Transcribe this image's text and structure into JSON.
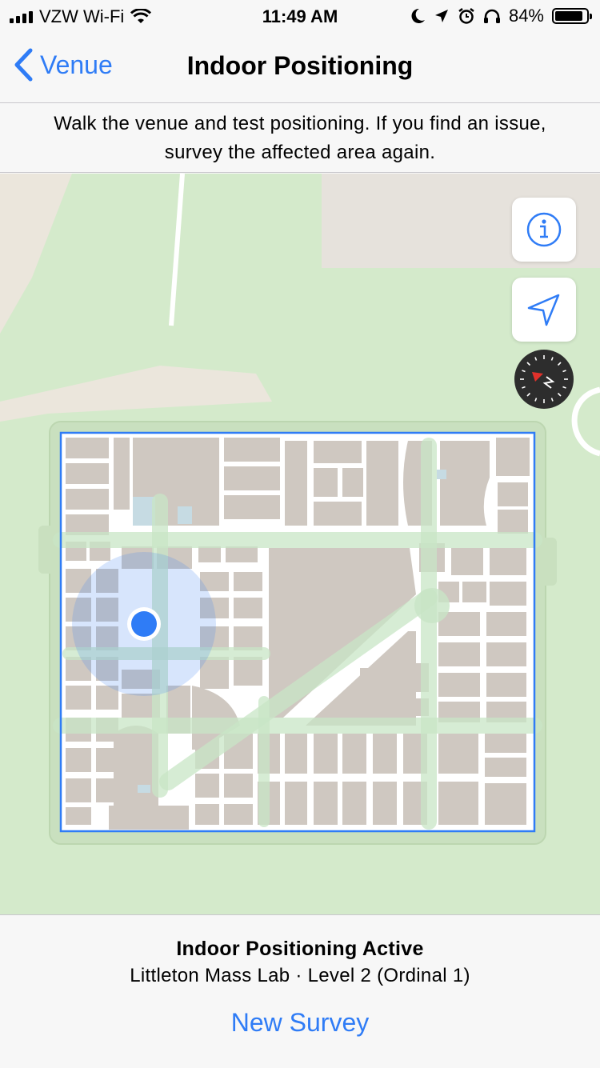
{
  "status_bar": {
    "carrier": "VZW Wi-Fi",
    "time": "11:49 AM",
    "battery": "84%"
  },
  "nav": {
    "back_label": "Venue",
    "title": "Indoor Positioning"
  },
  "banner": {
    "line1": "Walk the venue and test positioning. If you find an issue,",
    "line2": "survey the affected area again."
  },
  "map": {
    "controls": [
      "info-icon",
      "location-arrow-icon",
      "compass-icon"
    ],
    "accent_color": "#2f7cf6",
    "park_color": "#d4eacb",
    "building_color": "#cfc8c1"
  },
  "bottom": {
    "status_title": "Indoor Positioning Active",
    "venue_line": "Littleton Mass Lab · Level 2 (Ordinal 1)",
    "new_survey": "New Survey"
  }
}
